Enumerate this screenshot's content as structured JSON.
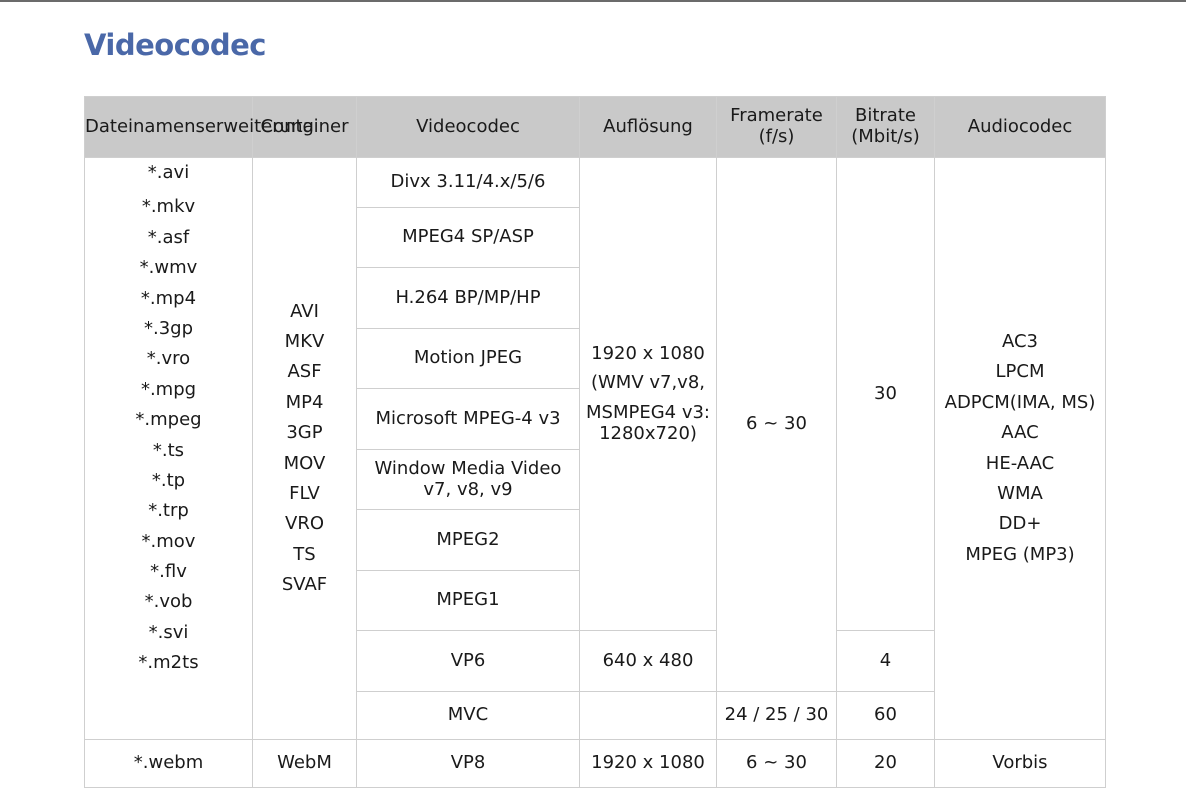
{
  "title": "Videocodec",
  "headers": {
    "extension": "Dateinamenserweiterung",
    "container": "Container",
    "videocodec": "Videocodec",
    "resolution": "Auflösung",
    "framerate_line1": "Framerate",
    "framerate_line2": "(f/s)",
    "bitrate_line1": "Bitrate",
    "bitrate_line2": "(Mbit/s)",
    "audiocodec": "Audiocodec"
  },
  "group1": {
    "extensions": [
      "*.avi",
      "*.mkv",
      "*.asf",
      "*.wmv",
      "*.mp4",
      "*.3gp",
      "*.vro",
      "*.mpg",
      "*.mpeg",
      "*.ts",
      "*.tp",
      "*.trp",
      "*.mov",
      "*.flv",
      "*.vob",
      "*.svi",
      "*.m2ts"
    ],
    "containers": [
      "AVI",
      "MKV",
      "ASF",
      "MP4",
      "3GP",
      "MOV",
      "FLV",
      "VRO",
      "TS",
      "SVAF"
    ],
    "audiocodecs": [
      "AC3",
      "LPCM",
      "ADPCM(IMA, MS)",
      "AAC",
      "HE-AAC",
      "WMA",
      "DD+",
      "MPEG (MP3)"
    ],
    "main_resolution": {
      "line1": "1920 x 1080",
      "line2": "(WMV v7,v8,",
      "line3": "MSMPEG4 v3:",
      "line4": "1280x720)"
    },
    "main_framerate": "6 ~ 30",
    "main_bitrate": "30",
    "videocodecs": [
      "Divx 3.11/4.x/5/6",
      "MPEG4 SP/ASP",
      "H.264 BP/MP/HP",
      "Motion JPEG",
      "Microsoft MPEG-4 v3",
      "Window Media Video v7, v8, v9",
      "MPEG2",
      "MPEG1"
    ],
    "vp6": {
      "codec": "VP6",
      "resolution": "640 x 480",
      "bitrate": "4"
    },
    "mvc": {
      "codec": "MVC",
      "resolution": "",
      "framerate": "24 / 25 / 30",
      "bitrate": "60"
    }
  },
  "group2": {
    "extension": "*.webm",
    "container": "WebM",
    "videocodec": "VP8",
    "resolution": "1920 x 1080",
    "framerate": "6 ~ 30",
    "bitrate": "20",
    "audiocodec": "Vorbis"
  }
}
